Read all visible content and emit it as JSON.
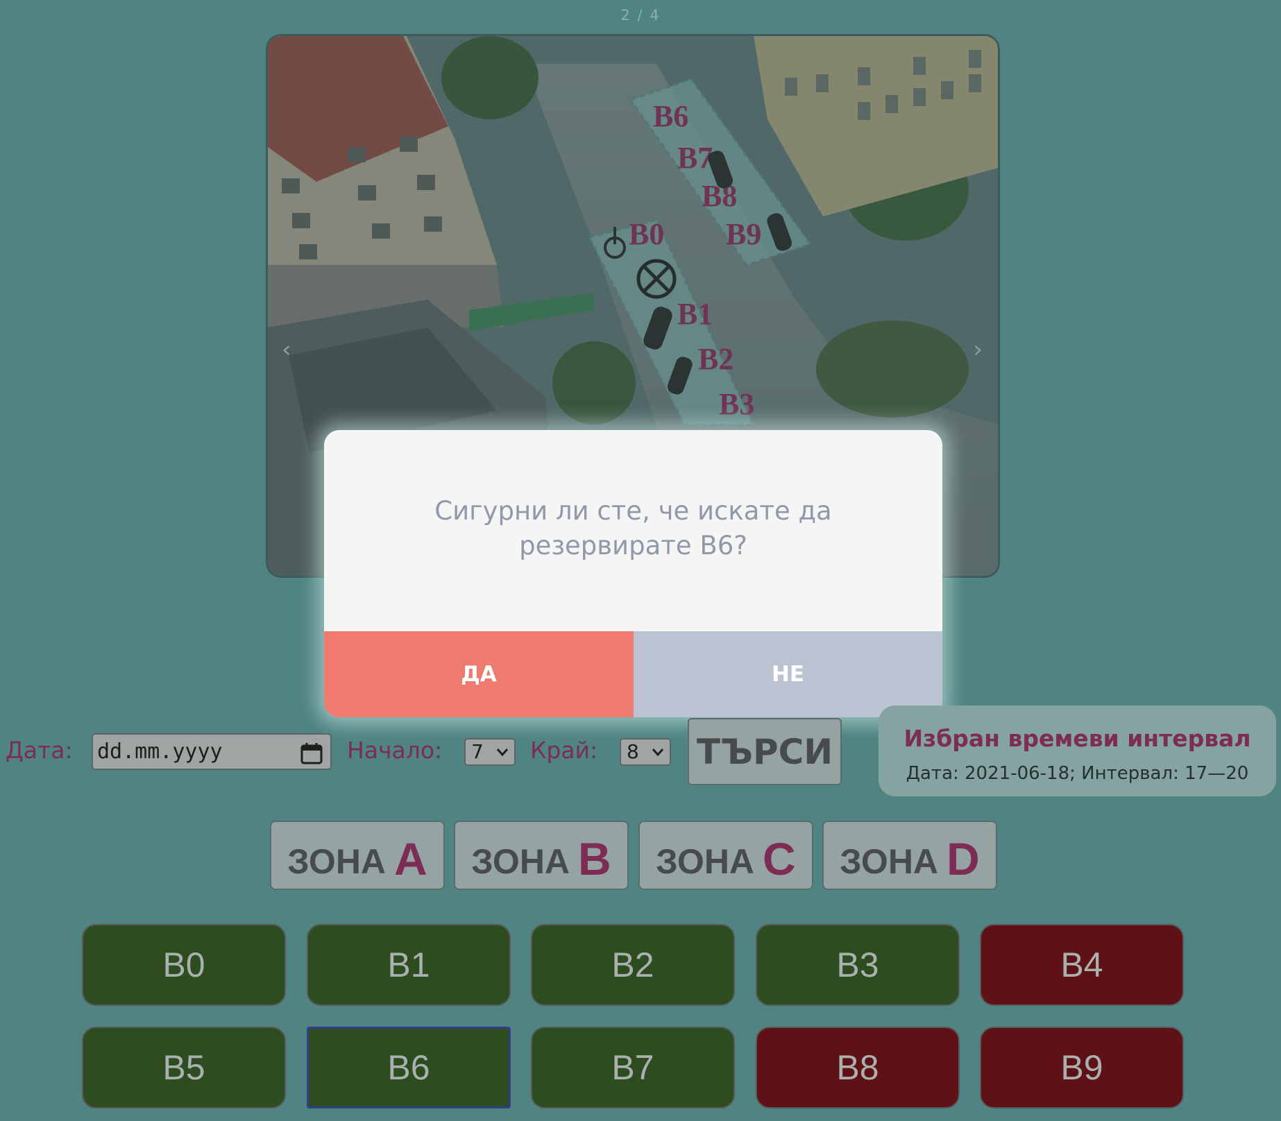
{
  "carousel": {
    "counter": "2 / 4",
    "prev_icon": "‹",
    "next_icon": "›",
    "map_labels": [
      "B6",
      "B7",
      "B8",
      "B9",
      "B0",
      "B1",
      "B2",
      "B3"
    ]
  },
  "dialog": {
    "line1": "Сигурни ли сте, че искате да",
    "line2": "резервирате В6?",
    "yes": "ДА",
    "no": "НЕ"
  },
  "form": {
    "date_label": "Дата:",
    "date_placeholder": "dd.mm.yyyy",
    "start_label": "Начало:",
    "start_value": "7",
    "end_label": "Край:",
    "end_value": "8",
    "search": "ТЪРСИ"
  },
  "info": {
    "title": "Избран времеви интервал",
    "subtitle": "Дата: 2021-06-18; Интервал: 17—20"
  },
  "zones": [
    {
      "word": "ЗОНА",
      "letter": "A"
    },
    {
      "word": "ЗОНА",
      "letter": "B"
    },
    {
      "word": "ЗОНА",
      "letter": "C"
    },
    {
      "word": "ЗОНА",
      "letter": "D"
    }
  ],
  "spots": [
    {
      "label": "B0",
      "status": "free"
    },
    {
      "label": "B1",
      "status": "free"
    },
    {
      "label": "B2",
      "status": "free"
    },
    {
      "label": "B3",
      "status": "free"
    },
    {
      "label": "B4",
      "status": "busy"
    },
    {
      "label": "B5",
      "status": "free"
    },
    {
      "label": "B6",
      "status": "free",
      "selected": true
    },
    {
      "label": "B7",
      "status": "free"
    },
    {
      "label": "B8",
      "status": "busy"
    },
    {
      "label": "B9",
      "status": "busy"
    }
  ],
  "colors": {
    "free": "#2d4d21",
    "busy": "#5e1217",
    "accent": "#7d2d54",
    "yes": "#ef7a6f",
    "no": "#bbc2d2"
  }
}
